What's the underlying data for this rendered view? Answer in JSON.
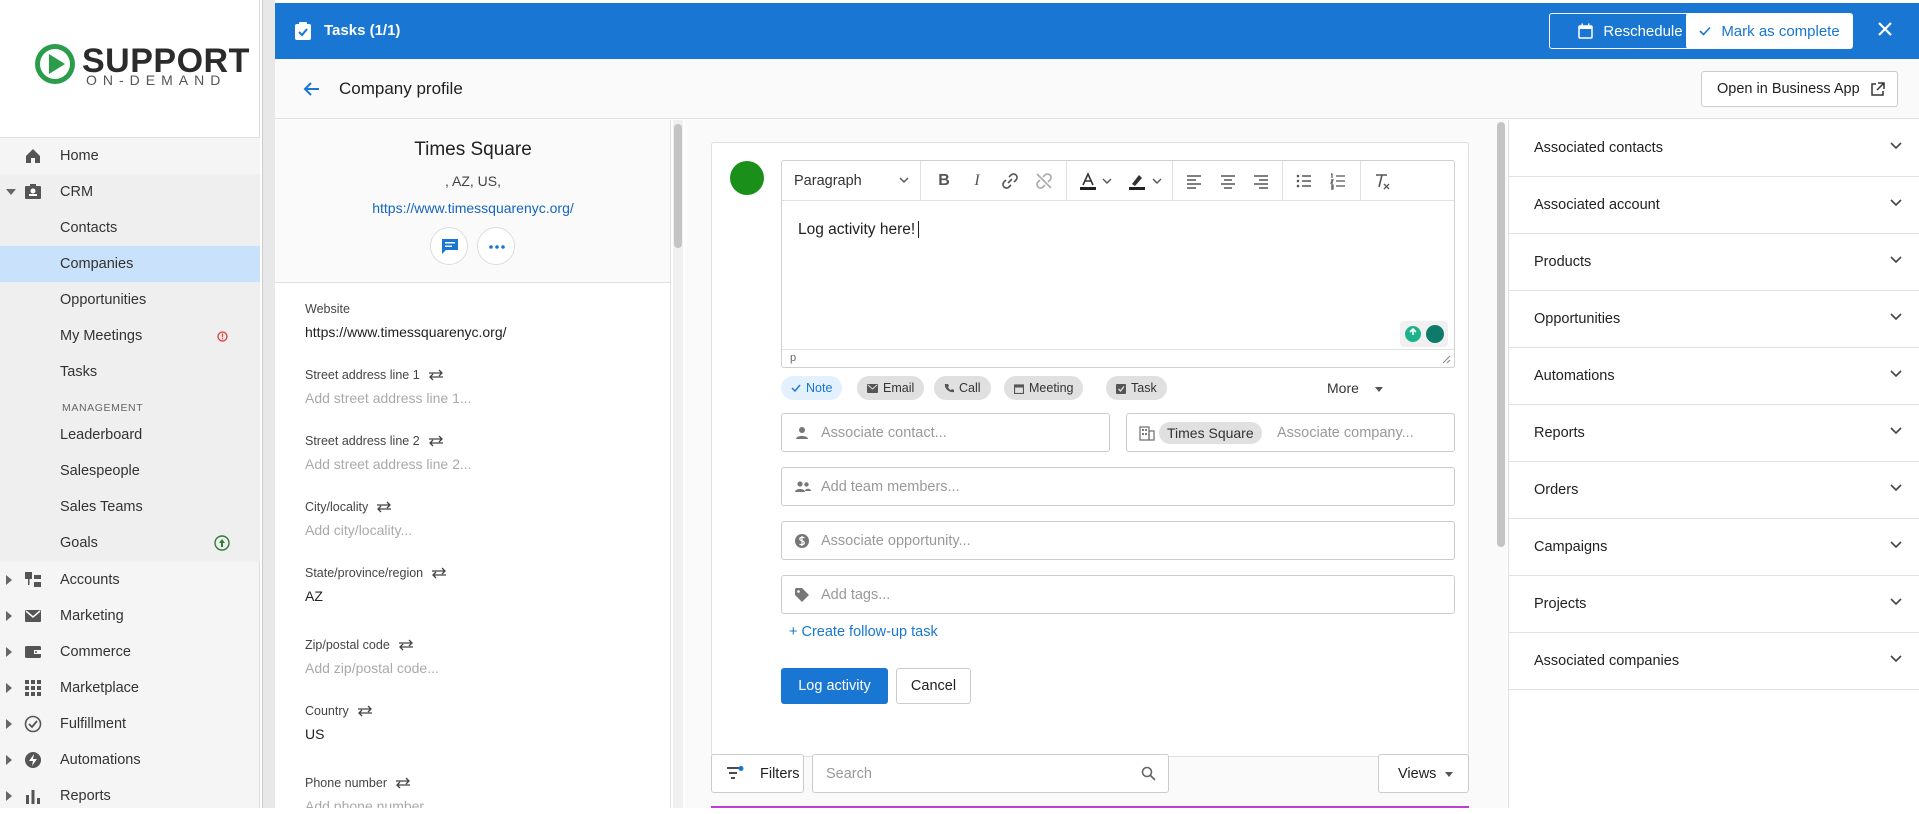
{
  "logo": {
    "title": "SUPPORT",
    "subtitle": "ON-DEMAND"
  },
  "nav": {
    "home": "Home",
    "crm": "CRM",
    "contacts": "Contacts",
    "companies": "Companies",
    "opportunities": "Opportunities",
    "my_meetings": "My Meetings",
    "tasks": "Tasks",
    "management_header": "MANAGEMENT",
    "leaderboard": "Leaderboard",
    "salespeople": "Salespeople",
    "sales_teams": "Sales Teams",
    "goals": "Goals",
    "accounts": "Accounts",
    "marketing": "Marketing",
    "commerce": "Commerce",
    "marketplace": "Marketplace",
    "fulfillment": "Fulfillment",
    "automations": "Automations",
    "reports": "Reports"
  },
  "topbar": {
    "title": "Tasks  (1/1)",
    "reschedule": "Reschedule",
    "mark_complete": "Mark as complete"
  },
  "header": {
    "title": "Company profile",
    "open_button": "Open in Business App"
  },
  "profile": {
    "name": "Times Square",
    "location": ", AZ, US,",
    "url": "https://www.timessquarenyc.org/",
    "fields": {
      "website_label": "Website",
      "website_value": "https://www.timessquarenyc.org/",
      "street1_label": "Street address line 1",
      "street1_placeholder": "Add street address line 1...",
      "street2_label": "Street address line 2",
      "street2_placeholder": "Add street address line 2...",
      "city_label": "City/locality",
      "city_placeholder": "Add city/locality...",
      "state_label": "State/province/region",
      "state_value": "AZ",
      "zip_label": "Zip/postal code",
      "zip_placeholder": "Add zip/postal code...",
      "country_label": "Country",
      "country_value": "US",
      "phone_label": "Phone number",
      "phone_placeholder": "Add phone number..."
    }
  },
  "editor": {
    "block_format": "Paragraph",
    "content": "Log activity here!",
    "status_path": "p",
    "chips": [
      "Note",
      "Email",
      "Call",
      "Meeting",
      "Task"
    ],
    "more": "More",
    "contact_placeholder": "Associate contact...",
    "company_chip": "Times Square",
    "company_placeholder": "Associate company...",
    "team_placeholder": "Add team members...",
    "opportunity_placeholder": "Associate opportunity...",
    "tags_placeholder": "Add tags...",
    "follow_up": "+ Create follow-up task",
    "log_button": "Log activity",
    "cancel_button": "Cancel"
  },
  "activity_bar": {
    "filters": "Filters",
    "search_placeholder": "Search",
    "views": "Views"
  },
  "right_panel": [
    "Associated contacts",
    "Associated account",
    "Products",
    "Opportunities",
    "Automations",
    "Reports",
    "Orders",
    "Campaigns",
    "Projects",
    "Associated companies"
  ],
  "colors": {
    "primary": "#1976d2",
    "avatar": "#1a8f1a",
    "active_nav": "#c9e1fb"
  }
}
